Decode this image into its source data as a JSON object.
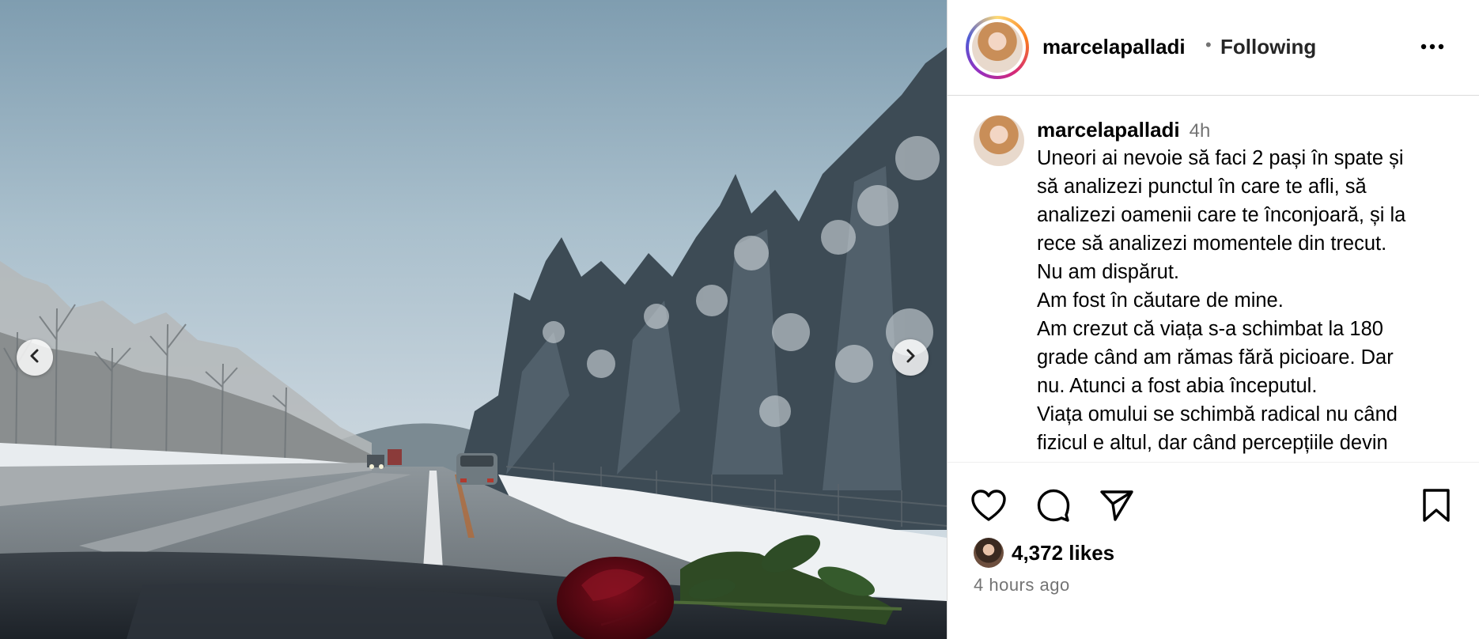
{
  "post": {
    "media": {
      "description_alt": "",
      "prev_icon": "chevron-left-icon",
      "next_icon": "chevron-right-icon"
    },
    "header": {
      "username": "marcelapalladi",
      "separator": "•",
      "follow_status": "Following",
      "more_icon": "more-horizontal-icon"
    },
    "caption": {
      "username": "marcelapalladi",
      "time": "4h",
      "lines": [
        "Uneori ai nevoie să faci 2 pași în spate și",
        "să analizezi punctul în care te afli, să",
        "analizezi oamenii care te înconjoară, și la",
        "rece să analizezi momentele din trecut.",
        "Nu am dispărut.",
        "Am fost în căutare de mine.",
        "Am crezut că viața s-a schimbat la 180",
        "grade când am rămas fără picioare. Dar",
        "nu. Atunci a fost abia începutul.",
        "Viața omului se schimbă radical nu când",
        "fizicul e altul, dar când percepțiile devin"
      ]
    },
    "actions": {
      "like_icon": "heart-icon",
      "comment_icon": "comment-icon",
      "share_icon": "send-icon",
      "save_icon": "bookmark-icon"
    },
    "likes": "4,372 likes",
    "time_ago": "4 hours ago"
  }
}
